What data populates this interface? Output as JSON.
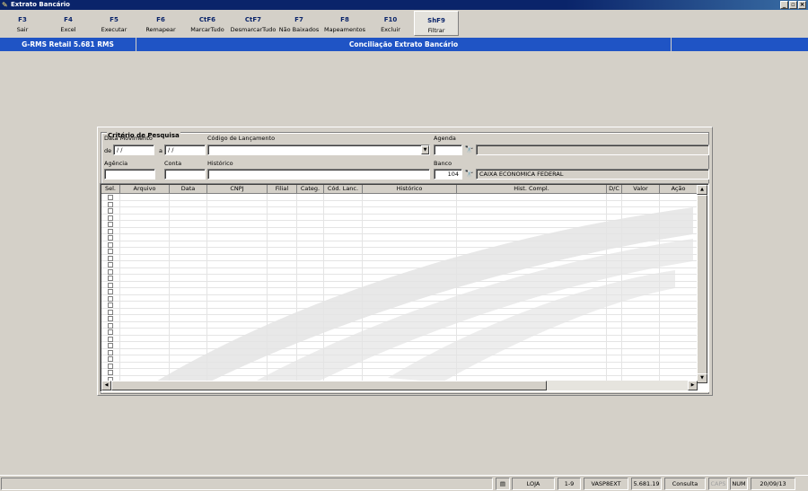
{
  "window": {
    "title": "Extrato Bancário"
  },
  "toolbar": [
    {
      "key": "F3",
      "label": "Sair"
    },
    {
      "key": "F4",
      "label": "Excel"
    },
    {
      "key": "F5",
      "label": "Executar"
    },
    {
      "key": "F6",
      "label": "Remapear"
    },
    {
      "key": "CtF6",
      "label": "MarcarTudo"
    },
    {
      "key": "CtF7",
      "label": "DesmarcarTudo"
    },
    {
      "key": "F7",
      "label": "Não Baixados"
    },
    {
      "key": "F8",
      "label": "Mapeamentos"
    },
    {
      "key": "F10",
      "label": "Excluir"
    },
    {
      "key": "ShF9",
      "label": "Filtrar"
    }
  ],
  "header": {
    "app": "G-RMS Retail 5.681 RMS",
    "screen": "Conciliação Extrato Bancário"
  },
  "criteria": {
    "title": "Critério de Pesquisa",
    "data_movimento_label": "Data Movimento",
    "de_label": "de",
    "a_label": "a",
    "date_from": " / /",
    "date_to": " / /",
    "codigo_lancamento_label": "Código de Lançamento",
    "codigo_lancamento_value": "",
    "agenda_label": "Agenda",
    "agenda_value": "",
    "agenda_desc": "",
    "agencia_label": "Agência",
    "agencia_value": "",
    "conta_label": "Conta",
    "conta_value": "",
    "historico_label": "Histórico",
    "historico_value": "",
    "banco_label": "Banco",
    "banco_value": "104",
    "banco_desc": "CAIXA ECONOMICA FEDERAL"
  },
  "grid": {
    "columns": [
      "Sel.",
      "Arquivo",
      "Data",
      "CNPJ",
      "Filial",
      "Categ.",
      "Cód. Lanc.",
      "Histórico",
      "Hist. Compl.",
      "D/C",
      "Valor",
      "Ação"
    ],
    "row_count": 28
  },
  "statusbar": {
    "loja": "LOJA",
    "range": "1-9",
    "program": "VASP8EXT",
    "version": "5.681.19",
    "mode": "Consulta",
    "caps": "CAPS",
    "num": "NUM",
    "date": "20/09/13"
  }
}
